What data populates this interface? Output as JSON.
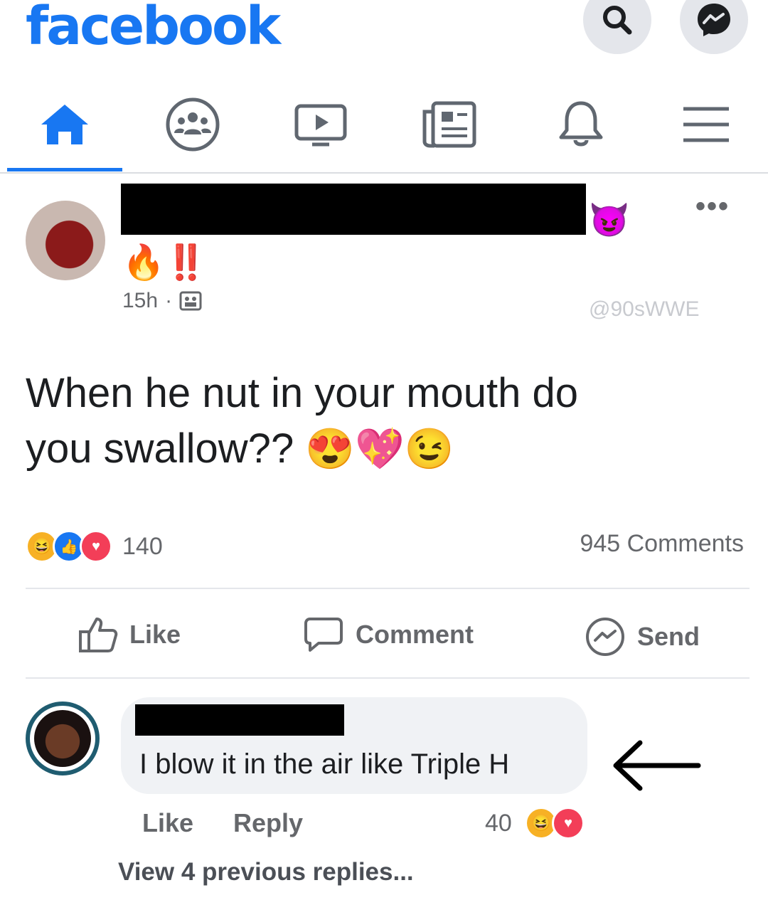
{
  "header": {
    "logo": "facebook",
    "search_icon": "search-icon",
    "messenger_icon": "messenger-icon",
    "brand_color": "#1877f2"
  },
  "nav": {
    "items": [
      "home-icon",
      "groups-icon",
      "watch-icon",
      "news-icon",
      "bell-icon",
      "menu-icon"
    ],
    "active": "home"
  },
  "post": {
    "author_emoji_after_name": "😈",
    "name_line2": "🔥‼️",
    "time": "15h",
    "privacy_icon": "friends-icon",
    "watermark": "@90sWWE",
    "text_line1": "When he nut in your mouth do",
    "text_line2": "you swallow??",
    "text_emojis": "😍💖😉",
    "reaction_count": "140",
    "comments_count": "945 Comments",
    "actions": {
      "like": "Like",
      "comment": "Comment",
      "send": "Send"
    }
  },
  "comment": {
    "text": "I blow it in the air like Triple H",
    "like": "Like",
    "reply": "Reply",
    "reaction_count": "40",
    "view_replies": "View 4 previous replies..."
  }
}
